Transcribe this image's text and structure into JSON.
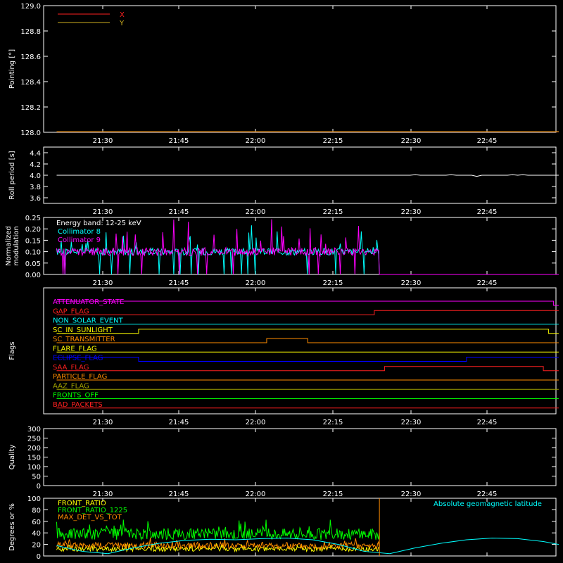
{
  "time_ticks": [
    "21:30",
    "21:45",
    "22:00",
    "22:15",
    "22:30",
    "22:45"
  ],
  "chart_data": [
    {
      "id": "pointing",
      "type": "line",
      "ylabel": "Pointing [°]",
      "ylim": [
        128.0,
        129.0
      ],
      "yticks": [
        "128.0",
        "128.2",
        "128.4",
        "128.6",
        "128.8",
        "129.0"
      ],
      "ytick_values": [
        128.0,
        128.2,
        128.4,
        128.6,
        128.8,
        129.0
      ],
      "legend_position": "top-left",
      "series": [
        {
          "name": "X",
          "color": "#ff2020",
          "label_color": "#ff2020",
          "x": [
            "21:21",
            "22:59"
          ],
          "values": [
            128.0,
            128.0
          ]
        },
        {
          "name": "Y",
          "color": "#d0b020",
          "label_color": "#d0b020",
          "x": [
            "21:21",
            "22:59"
          ],
          "values": [
            128.0,
            128.0
          ]
        }
      ]
    },
    {
      "id": "roll",
      "type": "line",
      "ylabel": "Roll period [s]",
      "ylim": [
        3.5,
        4.5
      ],
      "yticks": [
        "3.6",
        "3.8",
        "4.0",
        "4.2",
        "4.4"
      ],
      "ytick_values": [
        3.6,
        3.8,
        4.0,
        4.2,
        4.4
      ],
      "series": [
        {
          "color": "#ffffff",
          "x": [
            "21:21",
            "22:30",
            "22:31",
            "22:32",
            "22:37",
            "22:38",
            "22:39",
            "22:42",
            "22:43",
            "22:44",
            "22:49",
            "22:50",
            "22:51",
            "22:52",
            "22:53",
            "22:59"
          ],
          "values": [
            4.0,
            4.0,
            4.01,
            4.0,
            4.0,
            4.01,
            4.0,
            4.0,
            3.98,
            4.0,
            4.0,
            4.01,
            4.0,
            4.01,
            4.0,
            4.0
          ]
        }
      ]
    },
    {
      "id": "modulation",
      "type": "line",
      "ylabel": "Normalized modulation",
      "ylim": [
        0.0,
        0.25
      ],
      "yticks": [
        "0.00",
        "0.05",
        "0.10",
        "0.15",
        "0.20",
        "0.25"
      ],
      "ytick_values": [
        0.0,
        0.05,
        0.1,
        0.15,
        0.2,
        0.25
      ],
      "annotation": "Energy band: 12-25 keV",
      "legend_position": "top-left",
      "series": [
        {
          "name": "Collimator 8",
          "color": "#00ffff",
          "x_start": "21:21",
          "x_end": "22:24",
          "baseline": 0.1,
          "spread": 0.05,
          "drop_end": "22:59"
        },
        {
          "name": "Collimator 9",
          "color": "#ff00ff",
          "x_start": "21:21",
          "x_end": "22:24",
          "baseline": 0.1,
          "spread": 0.06,
          "drop_end": "22:59"
        }
      ]
    },
    {
      "id": "flags",
      "type": "line",
      "ylabel": "Flags",
      "series": [
        {
          "name": "ATTENUATOR_STATE",
          "color": "#ff00ff",
          "x": [
            "21:21",
            "22:58",
            "22:58",
            "22:59"
          ],
          "values": [
            1,
            1,
            0,
            0
          ]
        },
        {
          "name": "GAP_FLAG",
          "color": "#ff2020",
          "x": [
            "21:21",
            "22:23",
            "22:23",
            "22:59"
          ],
          "values": [
            0,
            0,
            1,
            1
          ]
        },
        {
          "name": "NON_SOLAR_EVENT",
          "color": "#00ffff",
          "x": [
            "21:21",
            "22:59"
          ],
          "values": [
            0,
            0
          ]
        },
        {
          "name": "SC_IN_SUNLIGHT",
          "color": "#ffff00",
          "x": [
            "21:21",
            "21:37",
            "21:37",
            "22:57",
            "22:57",
            "22:59"
          ],
          "values": [
            0,
            0,
            1,
            1,
            0,
            0
          ]
        },
        {
          "name": "SC_TRANSMITTER",
          "color": "#ff8c00",
          "x": [
            "21:21",
            "22:02",
            "22:02",
            "22:10",
            "22:10",
            "22:59"
          ],
          "values": [
            0,
            0,
            1,
            1,
            0,
            0
          ]
        },
        {
          "name": "FLARE_FLAG",
          "color": "#ffff00",
          "x": [
            "21:21",
            "22:59"
          ],
          "values": [
            0,
            0
          ]
        },
        {
          "name": "ECLIPSE_FLAG",
          "color": "#0000ff",
          "x": [
            "21:21",
            "21:37",
            "21:37",
            "22:41",
            "22:41",
            "22:59"
          ],
          "values": [
            1,
            1,
            0,
            0,
            1,
            1
          ]
        },
        {
          "name": "SAA_FLAG",
          "color": "#ff2020",
          "x": [
            "21:21",
            "22:25",
            "22:25",
            "22:56",
            "22:56",
            "22:59"
          ],
          "values": [
            0,
            0,
            1,
            1,
            0,
            0
          ]
        },
        {
          "name": "PARTICLE_FLAG",
          "color": "#ff8c00",
          "x": [
            "21:21",
            "22:59"
          ],
          "values": [
            0,
            0
          ]
        },
        {
          "name": "AAZ_FLAG",
          "color": "#a0a000",
          "x": [
            "21:21",
            "22:59"
          ],
          "values": [
            0,
            0
          ]
        },
        {
          "name": "FRONTS_OFF",
          "color": "#00ff00",
          "x": [
            "21:21",
            "22:59"
          ],
          "values": [
            0,
            0
          ]
        },
        {
          "name": "BAD_PACKETS",
          "color": "#ff2020",
          "x": [
            "21:21",
            "22:59"
          ],
          "values": [
            0,
            0
          ]
        }
      ]
    },
    {
      "id": "quality",
      "type": "line",
      "ylabel": "Quality",
      "ylim": [
        0,
        300
      ],
      "yticks": [
        "0",
        "50",
        "100",
        "150",
        "200",
        "250",
        "300"
      ],
      "ytick_values": [
        0,
        50,
        100,
        150,
        200,
        250,
        300
      ],
      "series": []
    },
    {
      "id": "ratios",
      "type": "line",
      "ylabel": "Degrees or %",
      "ylim": [
        0,
        100
      ],
      "yticks": [
        "0",
        "20",
        "40",
        "60",
        "80",
        "100"
      ],
      "ytick_values": [
        0,
        20,
        40,
        60,
        80,
        100
      ],
      "legend_position": "top-left",
      "annotation": "Absolute geomagnetic latitude",
      "annotation_color": "#00ffff",
      "marker_time": "22:24",
      "marker_color": "#ff8c00",
      "series": [
        {
          "name": "FRONT_RATIO",
          "color": "#ffff00",
          "x_start": "21:21",
          "x_end": "22:24",
          "baseline": 12,
          "spread": 4
        },
        {
          "name": "FRONT_RATIO_1225",
          "color": "#00ff00",
          "x_start": "21:21",
          "x_end": "22:24",
          "baseline": 38,
          "spread": 10
        },
        {
          "name": "MAX_DET_VS_TOT",
          "color": "#ff8c00",
          "x_start": "21:21",
          "x_end": "22:24",
          "baseline": 18,
          "spread": 6
        },
        {
          "name": "Absolute geomagnetic latitude",
          "color": "#00ffff",
          "x": [
            "21:21",
            "21:26",
            "21:31",
            "21:36",
            "21:41",
            "21:46",
            "21:51",
            "21:56",
            "22:01",
            "22:06",
            "22:11",
            "22:16",
            "22:21",
            "22:26",
            "22:31",
            "22:36",
            "22:41",
            "22:46",
            "22:51",
            "22:56",
            "22:59"
          ],
          "values": [
            18,
            8,
            4,
            14,
            22,
            27,
            29,
            28,
            30,
            31,
            28,
            20,
            8,
            4,
            14,
            22,
            28,
            31,
            30,
            25,
            20
          ]
        }
      ]
    }
  ]
}
